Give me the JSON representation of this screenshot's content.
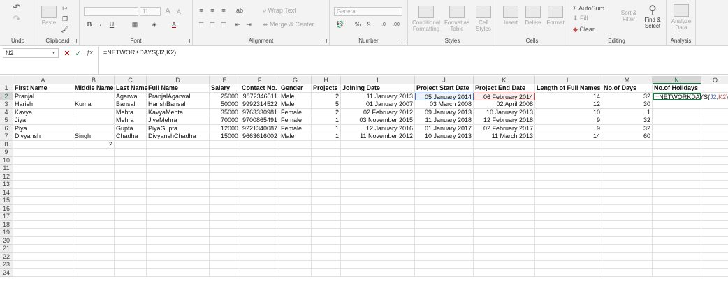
{
  "ribbon": {
    "undo_label": "Undo",
    "clipboard": {
      "paste": "Paste",
      "label": "Clipboard"
    },
    "font": {
      "size": "11",
      "label": "Font",
      "bold": "B",
      "italic": "I",
      "underline": "U",
      "grow": "A",
      "shrink": "A"
    },
    "alignment": {
      "wrap_text": "Wrap Text",
      "merge_center": "Merge & Center",
      "label": "Alignment"
    },
    "number": {
      "format": "General",
      "percent": "%",
      "comma": "9",
      "label": "Number"
    },
    "styles": {
      "conditional": "Conditional Formatting",
      "format_table": "Format as Table",
      "cell_styles": "Cell Styles",
      "label": "Styles"
    },
    "cells": {
      "insert": "Insert",
      "delete": "Delete",
      "format": "Format",
      "label": "Cells"
    },
    "editing": {
      "autosum": "AutoSum",
      "fill": "Fill",
      "clear": "Clear",
      "sort_filter": "Sort & Filter",
      "find_select": "Find & Select",
      "label": "Editing"
    },
    "analysis": {
      "analyze_data": "Analyze Data",
      "label": "Analysis"
    }
  },
  "formula_bar": {
    "name_box": "N2",
    "fx": "fx",
    "formula": "=NETWORKDAYS(J2,K2)"
  },
  "columns": [
    "A",
    "B",
    "C",
    "D",
    "E",
    "F",
    "G",
    "H",
    "I",
    "J",
    "K",
    "L",
    "M",
    "N",
    "O"
  ],
  "row_numbers": [
    "1",
    "2",
    "3",
    "4",
    "5",
    "6",
    "7",
    "8",
    "9",
    "10",
    "11",
    "12",
    "13",
    "14",
    "15",
    "16",
    "17",
    "18",
    "19",
    "20",
    "21",
    "22",
    "23",
    "24"
  ],
  "headers": [
    "First Name",
    "Middle Name",
    "Last Name",
    "Full Name",
    "Salary",
    "Contact No.",
    "Gender",
    "Projects",
    "Joining Date",
    "Project Start Date",
    "Project End Date",
    "Length of Full Names",
    "No.of Days",
    "No.of Holidays"
  ],
  "rows": [
    [
      "Pranjal",
      "",
      "Agarwal",
      "PranjalAgarwal",
      "25000",
      "9872346511",
      "Male",
      "2",
      "11 January 2013",
      "05 January 2014",
      "06 February 2014",
      "14",
      "32",
      "=NETWORKDAYS(J2,K2)"
    ],
    [
      "Harish",
      "Kumar",
      "Bansal",
      "HarishBansal",
      "50000",
      "9992314522",
      "Male",
      "5",
      "01 January 2007",
      "03 March 2008",
      "02 April 2008",
      "12",
      "30",
      ""
    ],
    [
      "Kavya",
      "",
      "Mehta",
      "KavyaMehta",
      "35000",
      "9763330981",
      "Female",
      "2",
      "02 February 2012",
      "09 January 2013",
      "10 January 2013",
      "10",
      "1",
      ""
    ],
    [
      "Jiya",
      "",
      "Mehra",
      "JiyaMehra",
      "70000",
      "9700865491",
      "Female",
      "1",
      "03 November 2015",
      "11 January 2018",
      "12 February 2018",
      "9",
      "32",
      ""
    ],
    [
      "Piya",
      "",
      "Gupta",
      "PiyaGupta",
      "12000",
      "9221340087",
      "Female",
      "1",
      "12 January 2016",
      "01 January 2017",
      "02 February 2017",
      "9",
      "32",
      ""
    ],
    [
      "Divyansh",
      "Singh",
      "Chadha",
      "DivyanshChadha",
      "15000",
      "9663616002",
      "Male",
      "1",
      "11 November 2012",
      "10 January 2013",
      "11 March 2013",
      "14",
      "60",
      ""
    ],
    [
      "",
      "2",
      "",
      "",
      "",
      "",
      "",
      "",
      "",
      "",
      "",
      "",
      "",
      ""
    ]
  ],
  "formula_parts": {
    "prefix": "=NETWORKDAYS(",
    "ref1": "J2",
    "comma": ",",
    "ref2": "K2",
    "suffix": ")"
  },
  "colors": {
    "accent": "#217346",
    "ref1": "#4472c4",
    "ref2": "#c0504d"
  }
}
